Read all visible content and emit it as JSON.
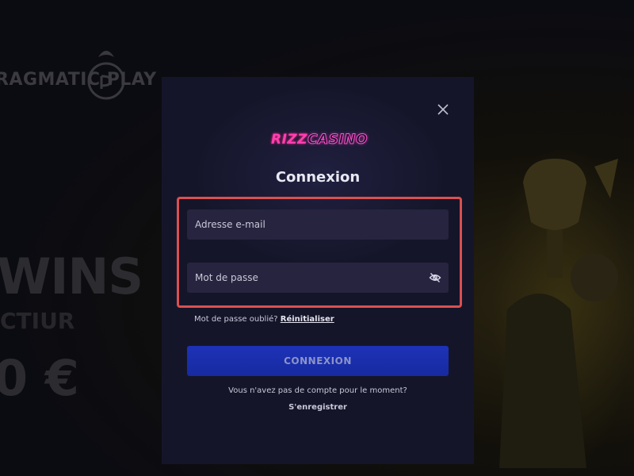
{
  "background": {
    "brand": "RAGMATIC PLAY",
    "promo_line1": "WINS",
    "promo_line2": "CTIUR",
    "promo_line3": "0 €"
  },
  "modal": {
    "logo_part1": "RIZZ",
    "logo_part2": "CASINO",
    "title": "Connexion",
    "email_placeholder": "Adresse e-mail",
    "password_placeholder": "Mot de passe",
    "forgot_text": "Mot de passe oublié?",
    "reset_link": "Réinitialiser",
    "submit_label": "CONNEXION",
    "no_account_text": "Vous n'avez pas de compte pour le moment?",
    "register_link": "S'enregistrer"
  },
  "icons": {
    "close": "close-icon",
    "eye": "eye-slash-icon"
  },
  "colors": {
    "modal_bg": "#15152a",
    "field_bg": "#27243f",
    "submit_bg": "#1d32b8",
    "highlight": "#d9504f",
    "logo_accent": "#ff3fb0"
  }
}
